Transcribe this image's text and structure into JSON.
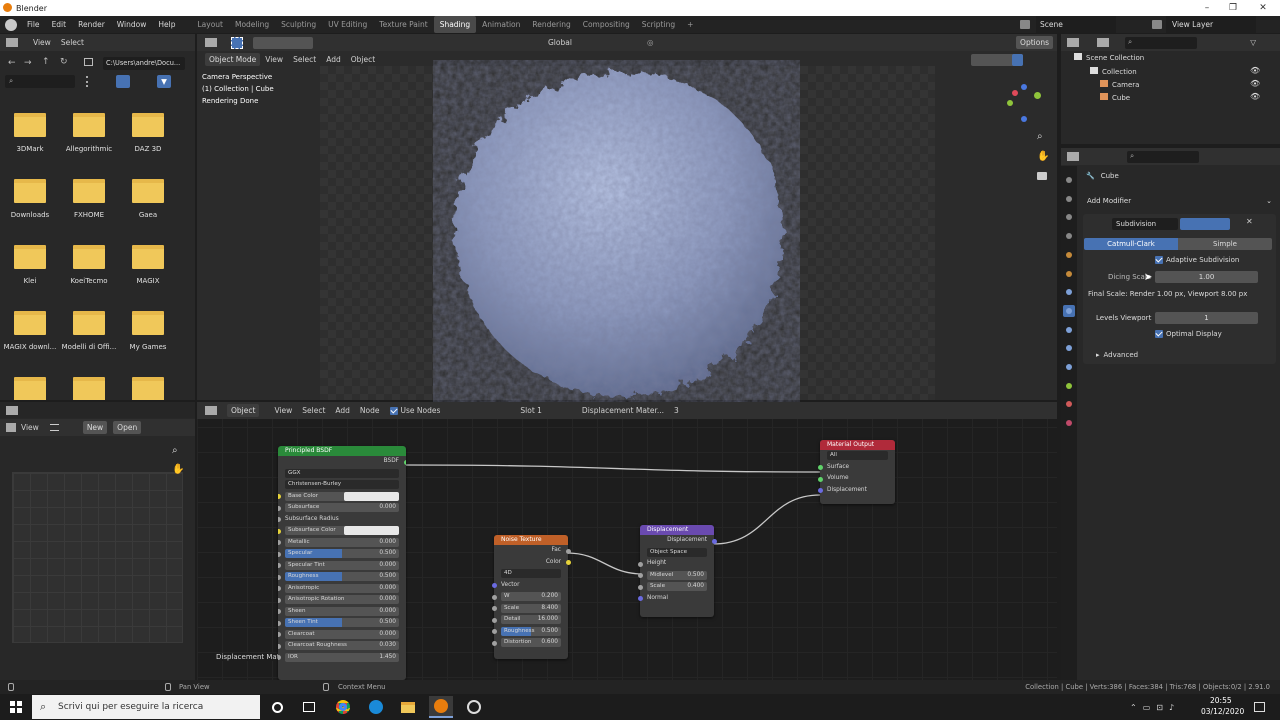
{
  "titlebar": {
    "app": "Blender",
    "min": "–",
    "max": "❐",
    "close": "✕"
  },
  "menu": [
    "File",
    "Edit",
    "Render",
    "Window",
    "Help"
  ],
  "workspaces": [
    "Layout",
    "Modeling",
    "Sculpting",
    "UV Editing",
    "Texture Paint",
    "Shading",
    "Animation",
    "Rendering",
    "Compositing",
    "Scripting"
  ],
  "active_workspace": "Shading",
  "scene": "Scene",
  "view_layer": "View Layer",
  "filebrowser": {
    "view": "View",
    "select": "Select",
    "path": "C:\\Users\\andre\\Docu...",
    "folders": [
      "3DMark",
      "Allegorithmic",
      "DAZ 3D",
      "Downloads",
      "FXHOME",
      "Gaea",
      "Klei",
      "KoeiTecmo",
      "MAGIX",
      "MAGIX downl...",
      "Modelli di Offi...",
      "My Games"
    ]
  },
  "viewport": {
    "mode": "Object Mode",
    "view": "View",
    "select": "Select",
    "add": "Add",
    "object": "Object",
    "transform": "Global",
    "options": "Options",
    "overlay_line1": "Camera Perspective",
    "overlay_line2": "(1) Collection | Cube",
    "overlay_line3": "Rendering Done"
  },
  "outliner": {
    "root": "Scene Collection",
    "collection": "Collection",
    "items": [
      "Camera",
      "Cube"
    ]
  },
  "properties": {
    "object": "Cube",
    "add_modifier": "Add Modifier",
    "modifier_name": "Subdivision",
    "tab_catmull": "Catmull-Clark",
    "tab_simple": "Simple",
    "adaptive": "Adaptive Subdivision",
    "dicing_label": "Dicing Scale",
    "dicing_value": "1.00",
    "final_scale": "Final Scale: Render 1.00 px, Viewport 8.00 px",
    "levels_label": "Levels Viewport",
    "levels_value": "1",
    "optimal": "Optimal Display",
    "advanced": "Advanced"
  },
  "image_editor": {
    "view": "View",
    "new": "New",
    "open": "Open"
  },
  "node_editor": {
    "object": "Object",
    "view": "View",
    "select": "Select",
    "add": "Add",
    "node": "Node",
    "use_nodes": "Use Nodes",
    "slot": "Slot 1",
    "material": "Displacement Mater...",
    "users": "3",
    "material_label": "Displacement Material"
  },
  "bsdf": {
    "title": "Principled BSDF",
    "out": "BSDF",
    "dist": "GGX",
    "sss": "Christensen-Burley",
    "rows": [
      {
        "k": "Base Color",
        "v": ""
      },
      {
        "k": "Subsurface",
        "v": "0.000"
      },
      {
        "k": "Subsurface Radius",
        "v": ""
      },
      {
        "k": "Subsurface Color",
        "v": ""
      },
      {
        "k": "Metallic",
        "v": "0.000"
      },
      {
        "k": "Specular",
        "v": "0.500"
      },
      {
        "k": "Specular Tint",
        "v": "0.000"
      },
      {
        "k": "Roughness",
        "v": "0.500"
      },
      {
        "k": "Anisotropic",
        "v": "0.000"
      },
      {
        "k": "Anisotropic Rotation",
        "v": "0.000"
      },
      {
        "k": "Sheen",
        "v": "0.000"
      },
      {
        "k": "Sheen Tint",
        "v": "0.500"
      },
      {
        "k": "Clearcoat",
        "v": "0.000"
      },
      {
        "k": "Clearcoat Roughness",
        "v": "0.030"
      },
      {
        "k": "IOR",
        "v": "1.450"
      }
    ]
  },
  "noise": {
    "title": "Noise Texture",
    "fac": "Fac",
    "color": "Color",
    "dim": "4D",
    "vector": "Vector",
    "rows": [
      {
        "k": "W",
        "v": "0.200"
      },
      {
        "k": "Scale",
        "v": "8.400"
      },
      {
        "k": "Detail",
        "v": "16.000"
      },
      {
        "k": "Roughness",
        "v": "0.500"
      },
      {
        "k": "Distortion",
        "v": "0.600"
      }
    ]
  },
  "displacement": {
    "title": "Displacement",
    "out": "Displacement",
    "space": "Object Space",
    "height": "Height",
    "rows": [
      {
        "k": "Midlevel",
        "v": "0.500"
      },
      {
        "k": "Scale",
        "v": "0.400"
      }
    ],
    "normal": "Normal"
  },
  "matout": {
    "title": "Material Output",
    "target": "All",
    "surface": "Surface",
    "volume": "Volume",
    "disp": "Displacement"
  },
  "statusbar": {
    "pan": "Pan View",
    "ctx": "Context Menu",
    "stats": "Collection | Cube | Verts:386 | Faces:384 | Tris:768 | Objects:0/2 | 2.91.0"
  },
  "taskbar": {
    "search": "Scrivi qui per eseguire la ricerca",
    "time": "20:55",
    "date": "03/12/2020"
  },
  "colors": {
    "accent": "#4772b3",
    "bsdf_head": "#2a8a3a",
    "noise_head": "#c06028",
    "disp_head": "#6a4ab0",
    "out_head": "#b02a3a"
  }
}
